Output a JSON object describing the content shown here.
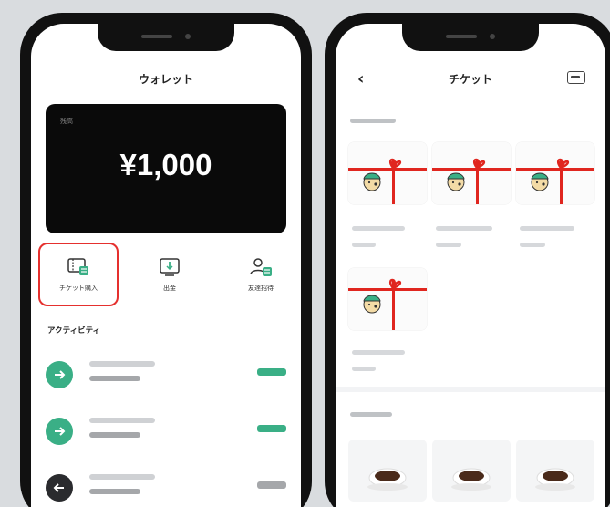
{
  "wallet": {
    "title": "ウォレット",
    "balance_label": "残高",
    "balance_amount": "¥1,000",
    "actions": [
      {
        "label": "チケット購入",
        "icon": "ticket-purchase-icon",
        "highlighted": true
      },
      {
        "label": "出金",
        "icon": "withdraw-icon",
        "highlighted": false
      },
      {
        "label": "友達招待",
        "icon": "invite-friend-icon",
        "highlighted": false
      }
    ],
    "activity_title": "アクティビティ",
    "activities": [
      {
        "icon": "arrow-right-icon",
        "icon_color": "#3aaf86",
        "badge_color": "#3aaf86"
      },
      {
        "icon": "arrow-right-icon",
        "icon_color": "#3aaf86",
        "badge_color": "#3aaf86"
      },
      {
        "icon": "arrow-left-icon",
        "icon_color": "#2a2b2e",
        "badge_color": "#a5a7aa"
      }
    ]
  },
  "tickets": {
    "title": "チケット",
    "colors": {
      "ribbon": "#e0261f",
      "accent": "#3aaf86"
    }
  }
}
